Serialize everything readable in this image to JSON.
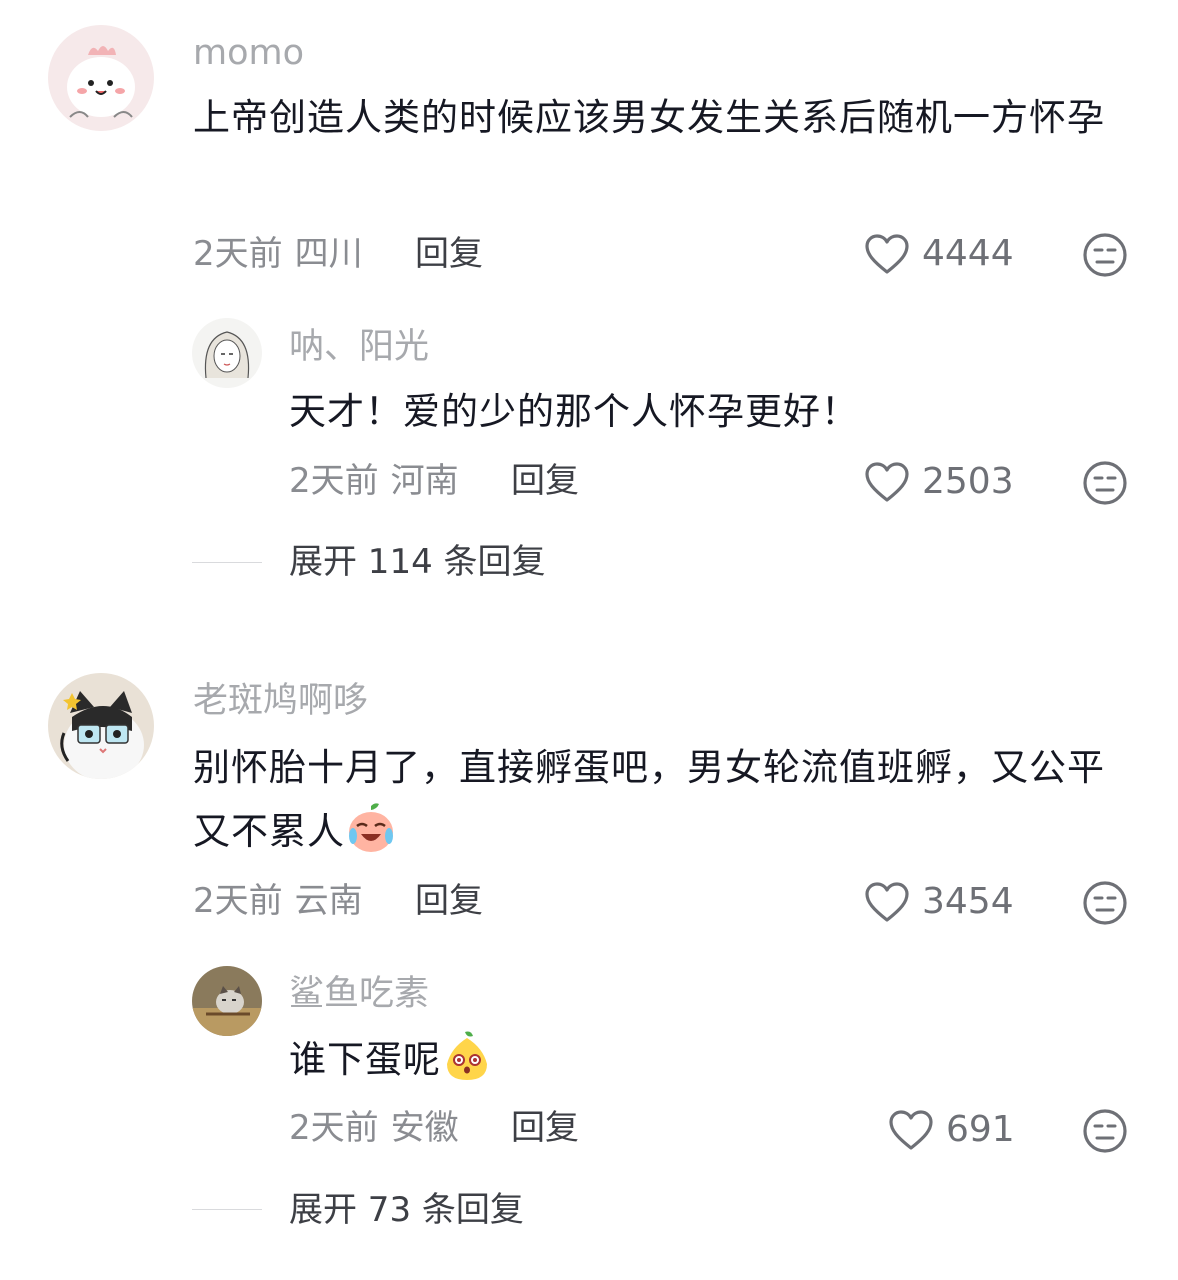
{
  "comments": [
    {
      "username": "momo",
      "content": "上帝创造人类的时候应该男女发生关系后随机一方怀孕",
      "time": "2天前",
      "location": "四川",
      "reply_label": "回复",
      "likes": "4444",
      "replies": [
        {
          "username": "呐、阳光",
          "content": "天才！爱的少的那个人怀孕更好！",
          "time": "2天前",
          "location": "河南",
          "reply_label": "回复",
          "likes": "2503"
        }
      ],
      "expand_label": "展开 114 条回复"
    },
    {
      "username": "老斑鸠啊哆",
      "content": "别怀胎十月了，直接孵蛋吧，男女轮流值班孵，又公平又不累人",
      "content_emoji": "crying-laughing-peach-emoji",
      "time": "2天前",
      "location": "云南",
      "reply_label": "回复",
      "likes": "3454",
      "replies": [
        {
          "username": "鲨鱼吃素",
          "content": "谁下蛋呢",
          "content_emoji": "surprised-pear-emoji",
          "time": "2天前",
          "location": "安徽",
          "reply_label": "回复",
          "likes": "691"
        }
      ],
      "expand_label": "展开 73 条回复"
    }
  ],
  "icons": {
    "like": "heart-outline-icon",
    "dislike": "meh-face-icon"
  },
  "colors": {
    "username": "#a7a9ad",
    "text": "#161823",
    "meta": "#8a8c91",
    "icon": "#6e7076"
  }
}
